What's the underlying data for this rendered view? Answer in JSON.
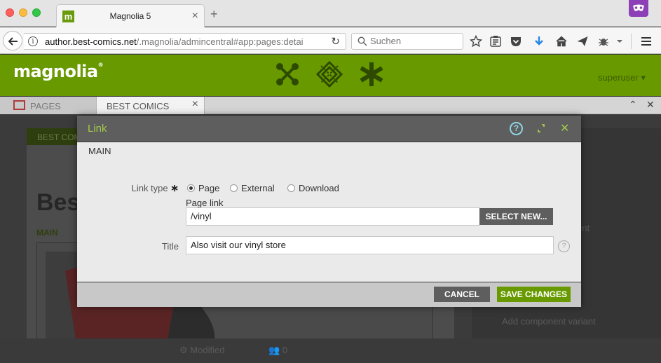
{
  "browser": {
    "tab_title": "Magnolia 5",
    "favicon_letter": "m",
    "url_host": "author.best-comics.net",
    "url_path": "/.magnolia/admincentral#app:pages:detai",
    "search_placeholder": "Suchen"
  },
  "magnolia": {
    "logo": "magnolia",
    "logo_mark": "®",
    "user": "superuser",
    "brand_color": "#689a00"
  },
  "app_tabs": [
    {
      "label": "PAGES"
    },
    {
      "label": "BEST COMICS"
    }
  ],
  "background": {
    "greenbar": "BEST COMI",
    "title": "Bes",
    "main_label": "MAIN",
    "right_items": [
      "ent",
      "Add component variant"
    ],
    "status_modified": "Modified",
    "status_count": "0"
  },
  "dialog": {
    "title": "Link",
    "section": "MAIN",
    "link_type_label": "Link type",
    "required_marker": "∗",
    "link_types": [
      {
        "label": "Page",
        "selected": true
      },
      {
        "label": "External",
        "selected": false
      },
      {
        "label": "Download",
        "selected": false
      }
    ],
    "page_link_label": "Page link",
    "page_link_value": "/vinyl",
    "select_new_label": "SELECT NEW...",
    "title_field_label": "Title",
    "title_field_value": "Also visit our vinyl store",
    "cancel_label": "CANCEL",
    "save_label": "SAVE CHANGES"
  }
}
